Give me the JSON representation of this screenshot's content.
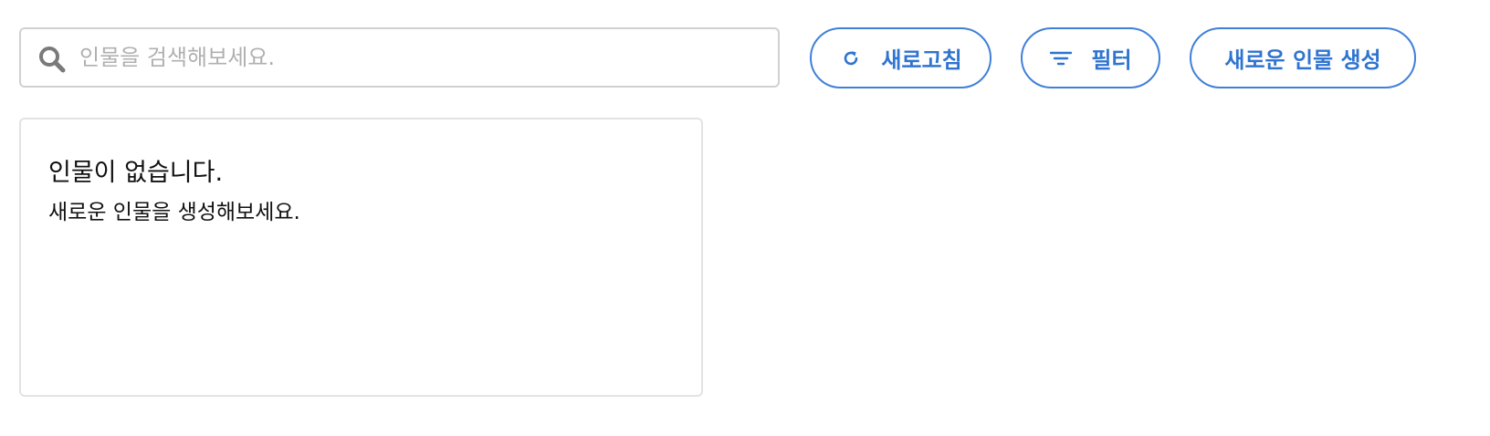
{
  "search": {
    "placeholder": "인물을 검색해보세요.",
    "value": "",
    "icon": "search-icon"
  },
  "toolbar": {
    "refresh_label": "새로고침",
    "refresh_icon": "refresh-icon",
    "filter_label": "필터",
    "filter_icon": "filter-icon",
    "create_label": "새로운 인물 생성"
  },
  "empty_state": {
    "title": "인물이 없습니다.",
    "subtitle": "새로운 인물을 생성해보세요."
  },
  "colors": {
    "accent": "#3f80d8",
    "accent_text": "#2f74d0",
    "border": "#d1d1d1",
    "card_border": "#e3e3e3",
    "placeholder": "#b0b0b0",
    "icon_gray": "#7a7a7a"
  }
}
